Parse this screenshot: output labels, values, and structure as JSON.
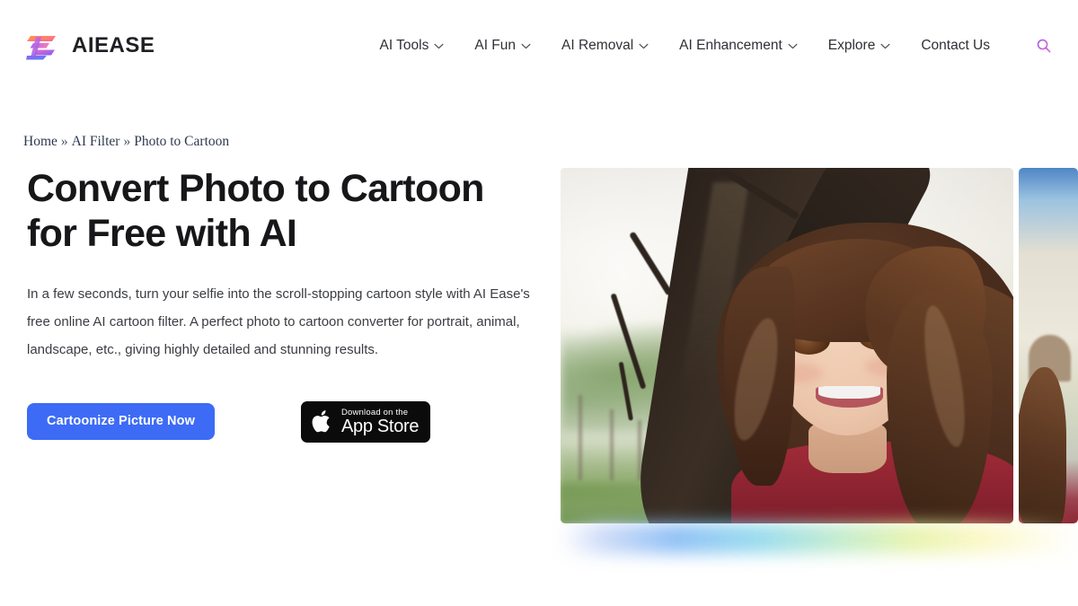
{
  "brand": {
    "name": "AIEASE",
    "logo_icon": "aiease-gradient-e-logo"
  },
  "nav": {
    "items": [
      {
        "label": "AI Tools",
        "has_dropdown": true
      },
      {
        "label": "AI Fun",
        "has_dropdown": true
      },
      {
        "label": "AI Removal",
        "has_dropdown": true
      },
      {
        "label": "AI Enhancement",
        "has_dropdown": true
      },
      {
        "label": "Explore",
        "has_dropdown": true
      },
      {
        "label": "Contact Us",
        "has_dropdown": false
      }
    ],
    "search_icon": "search-icon"
  },
  "breadcrumb": {
    "home": "Home",
    "sep1": "»",
    "category": "AI Filter",
    "sep2": "»",
    "current": "Photo to Cartoon"
  },
  "hero": {
    "title_line1": "Convert Photo to Cartoon",
    "title_line2": "for Free with AI",
    "description": "In a few seconds, turn your selfie into the scroll-stopping cartoon style with AI Ease's free online AI cartoon filter. A perfect photo to cartoon converter for portrait, animal, landscape, etc., giving highly detailed and stunning results.",
    "cta_label": "Cartoonize Picture Now",
    "appstore": {
      "small_label": "Download on the",
      "big_label": "App Store",
      "icon": "apple-logo-icon"
    },
    "media": {
      "main_alt": "Cartoon-style illustration of a smiling girl with long brown hair in a red shirt standing beside a large tree",
      "side_alt": "Partial second cartoon image preview"
    }
  },
  "colors": {
    "accent_blue": "#3d6bf6",
    "heading": "#17171a",
    "body_text": "#3a3d42",
    "nav_text": "#2f3136",
    "breadcrumb_text": "#2d3a4e",
    "appstore_bg": "#0b0b0b",
    "shirt_red": "#8c2330"
  }
}
